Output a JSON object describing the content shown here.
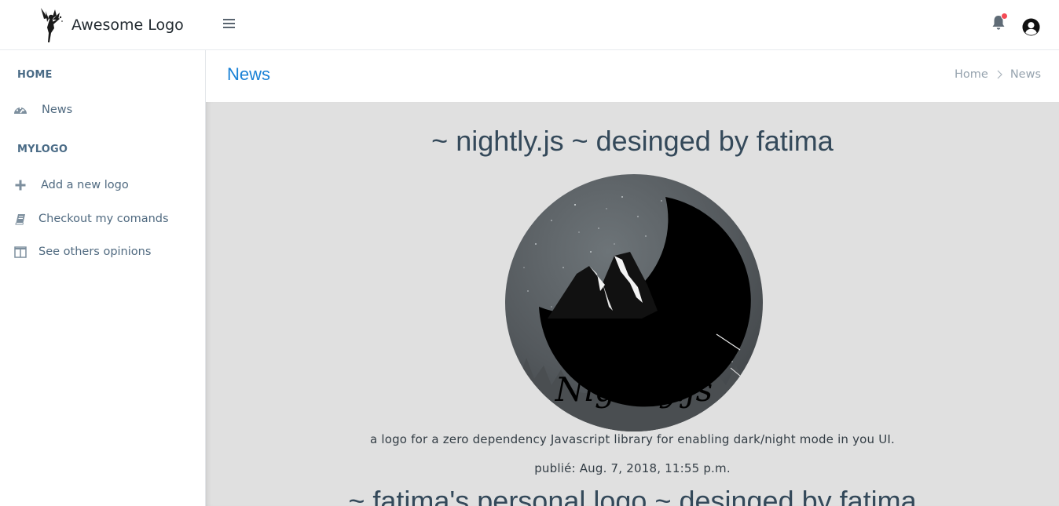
{
  "header": {
    "brand_name": "Awesome Logo",
    "brand_icon": "fairy-logo-icon",
    "menu_icon": "hamburger-icon",
    "notification_icon": "bell-icon",
    "notification_dot_color": "#f44a55",
    "user_icon": "user-avatar-icon"
  },
  "sidebar": {
    "sections": [
      {
        "heading": "HOME",
        "items": [
          {
            "label": "News",
            "icon": "dashboard-icon"
          }
        ]
      },
      {
        "heading": "MYLOGO",
        "items": [
          {
            "label": "Add a new logo",
            "icon": "plus-icon"
          },
          {
            "label": "Checkout my comands",
            "icon": "book-icon"
          },
          {
            "label": "See others opinions",
            "icon": "columns-icon"
          }
        ]
      }
    ]
  },
  "page": {
    "title": "News",
    "breadcrumb": [
      "Home",
      "News"
    ],
    "accent_color": "#1b82d6"
  },
  "posts": [
    {
      "title": "~ nightly.js ~ desinged by fatima",
      "image_text": "Nightly.js",
      "description": "a logo for a zero dependency Javascript library for enabling dark/night mode in you UI.",
      "date": "publié: Aug. 7, 2018, 11:55 p.m."
    },
    {
      "title": "~ fatima's personal logo ~ desinged by fatima"
    }
  ]
}
